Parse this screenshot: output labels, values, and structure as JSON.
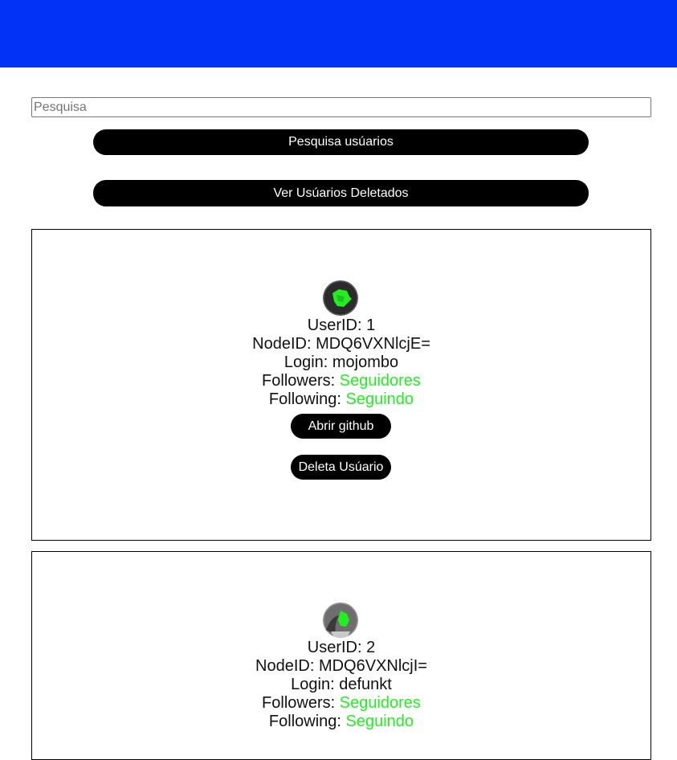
{
  "search": {
    "placeholder": "Pesquisa",
    "search_button_label": "Pesquisa usúarios",
    "deleted_button_label": "Ver Usúarios Deletados"
  },
  "users": [
    {
      "userid_label": "UserID: ",
      "userid": "1",
      "nodeid_label": "NodeID: ",
      "nodeid": "MDQ6VXNlcjE=",
      "login_label": "Login: ",
      "login": "mojombo",
      "followers_label": "Followers: ",
      "followers_link": "Seguidores",
      "following_label": "Following: ",
      "following_link": "Seguindo",
      "open_github_label": "Abrir github",
      "delete_label": "Deleta Usúario"
    },
    {
      "userid_label": "UserID: ",
      "userid": "2",
      "nodeid_label": "NodeID: ",
      "nodeid": "MDQ6VXNlcjI=",
      "login_label": "Login: ",
      "login": "defunkt",
      "followers_label": "Followers: ",
      "followers_link": "Seguidores",
      "following_label": "Following: ",
      "following_link": "Seguindo"
    }
  ],
  "colors": {
    "header": "#0033f5",
    "link": "#22ee22",
    "button": "#000000"
  }
}
